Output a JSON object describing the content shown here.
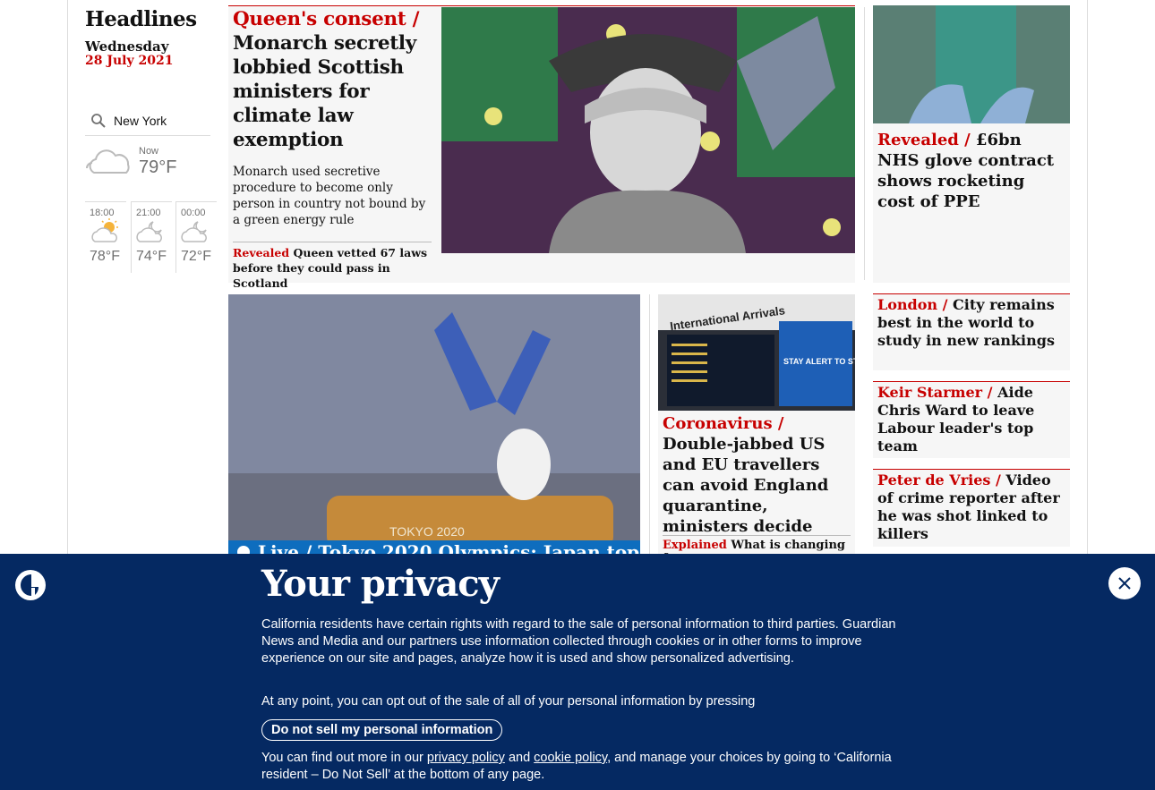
{
  "sidebar": {
    "title": "Headlines",
    "day": "Wednesday",
    "date": "28 July 2021",
    "search_value": "New York",
    "weather_now": {
      "label": "Now",
      "temp": "79°F",
      "icon": "cloudy-icon"
    },
    "forecast": [
      {
        "time": "18:00",
        "temp": "78°F",
        "icon": "partly-sunny-icon"
      },
      {
        "time": "21:00",
        "temp": "74°F",
        "icon": "cloudy-night-icon"
      },
      {
        "time": "00:00",
        "temp": "72°F",
        "icon": "cloudy-night-icon"
      }
    ]
  },
  "lead": {
    "kicker": "Queen's consent /",
    "headline": "Monarch secretly lobbied Scottish ministers for climate law exemption",
    "standfirst": "Monarch used secretive procedure to become only person in country not bound by a green energy rule",
    "sub_kicker": "Revealed",
    "sub_text": "Queen vetted 67 laws before they could pass in Scotland"
  },
  "side_stories": [
    {
      "kicker": "Revealed /",
      "text": "£6bn NHS glove contract shows rocketing cost of PPE"
    },
    {
      "kicker": "London /",
      "text": "City remains best in the world to study in new rankings"
    },
    {
      "kicker": "Keir Starmer /",
      "text": "Aide Chris Ward to leave Labour leader's top team"
    },
    {
      "kicker": "Peter de Vries /",
      "text": "Video of crime reporter after he was shot linked to killers"
    }
  ],
  "olympics": {
    "kicker": "Live /",
    "text": "Tokyo 2020 Olympics: Japan top",
    "image_text": "TOKYO 2020"
  },
  "covid": {
    "kicker": "Coronavirus /",
    "headline": "Double-jabbed US and EU travellers can avoid England quarantine, ministers decide",
    "sub_kicker": "Explained",
    "sub_text": "What is changing for",
    "image_banner": "International Arrivals",
    "image_sign": "STAY ALERT TO STAY SAFE"
  },
  "privacy": {
    "title": "Your privacy",
    "para1": "California residents have certain rights with regard to the sale of personal information to third parties. Guardian News and Media and our partners use information collected through cookies or in other forms to improve experience on our site and pages, analyze how it is used and show personalized advertising.",
    "para2": "At any point, you can opt out of the sale of all of your personal information by pressing",
    "button": "Do not sell my personal information",
    "para3_a": "You can find out more in our",
    "link_privacy": "privacy policy",
    "para3_and": "and",
    "link_cookie": "cookie policy",
    "para3_b": ", and manage your choices by going to ‘California resident – Do Not Sell’ at the bottom of any page."
  },
  "colors": {
    "accent": "#c70000",
    "banner": "#052962",
    "live": "#0e6dbe"
  }
}
